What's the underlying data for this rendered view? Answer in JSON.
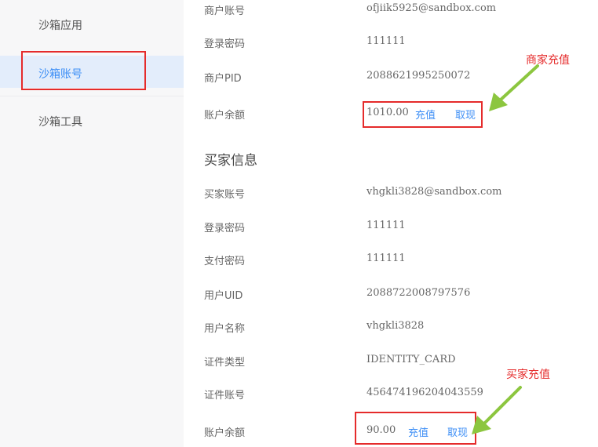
{
  "sidebar": {
    "items": [
      {
        "label": "沙箱应用"
      },
      {
        "label": "沙箱账号"
      },
      {
        "label": "沙箱工具"
      }
    ]
  },
  "merchant": {
    "rows": [
      {
        "label": "商户账号",
        "value": "ofjiik5925@sandbox.com"
      },
      {
        "label": "登录密码",
        "value": "111111"
      },
      {
        "label": "商户PID",
        "value": "2088621995250072"
      },
      {
        "label": "账户余额",
        "value": "1010.00"
      }
    ],
    "recharge_link": "充值",
    "withdraw_link": "取现"
  },
  "buyer": {
    "section_title": "买家信息",
    "rows": [
      {
        "label": "买家账号",
        "value": "vhgkli3828@sandbox.com"
      },
      {
        "label": "登录密码",
        "value": "111111"
      },
      {
        "label": "支付密码",
        "value": "111111"
      },
      {
        "label": "用户UID",
        "value": "2088722008797576"
      },
      {
        "label": "用户名称",
        "value": "vhgkli3828"
      },
      {
        "label": "证件类型",
        "value": "IDENTITY_CARD"
      },
      {
        "label": "证件账号",
        "value": "456474196204043559"
      },
      {
        "label": "账户余额",
        "value": "90.00"
      }
    ],
    "recharge_link": "充值",
    "withdraw_link": "取现"
  },
  "annotations": {
    "merchant_recharge": "商家充值",
    "buyer_recharge": "买家充值",
    "color": "#e52b2b",
    "arrow_color": "#8cc63f"
  },
  "colors": {
    "accent": "#3c8ef6",
    "active_bg": "#e3edfb"
  }
}
